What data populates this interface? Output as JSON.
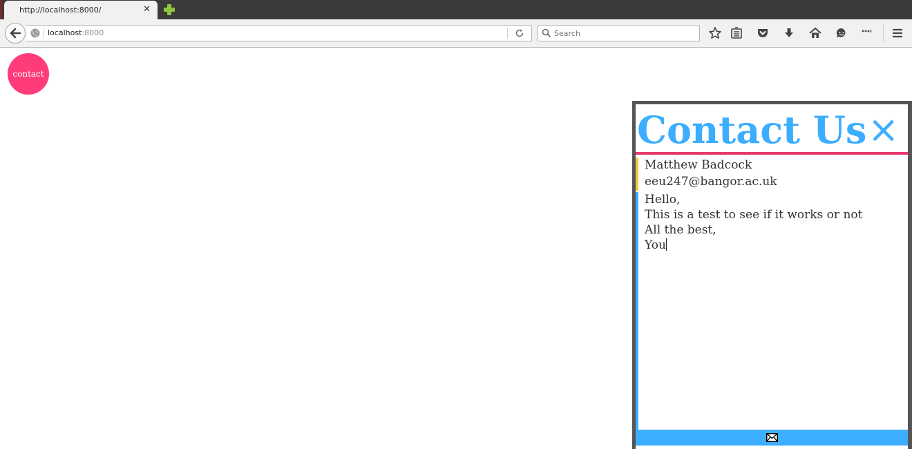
{
  "browser": {
    "tab": {
      "title": "http://localhost:8000/"
    },
    "url": {
      "host": "localhost",
      "port": ":8000"
    },
    "search": {
      "placeholder": "Search"
    }
  },
  "page": {
    "contact_button": "contact",
    "panel": {
      "title": "Contact Us",
      "close": "×",
      "name_value": "Matthew Badcock",
      "email_value": "eeu247@bangor.ac.uk",
      "message_value": "Hello,\nThis is a test to see if it works or not\nAll the best,\nYou",
      "send_icon": "envelope-icon"
    }
  },
  "colors": {
    "accent_blue": "#3daeff",
    "contact_pink": "#ff3b7a",
    "rule_pink": "#e83a6e",
    "field_yellow": "#f2cd37",
    "panel_border": "#555555"
  }
}
